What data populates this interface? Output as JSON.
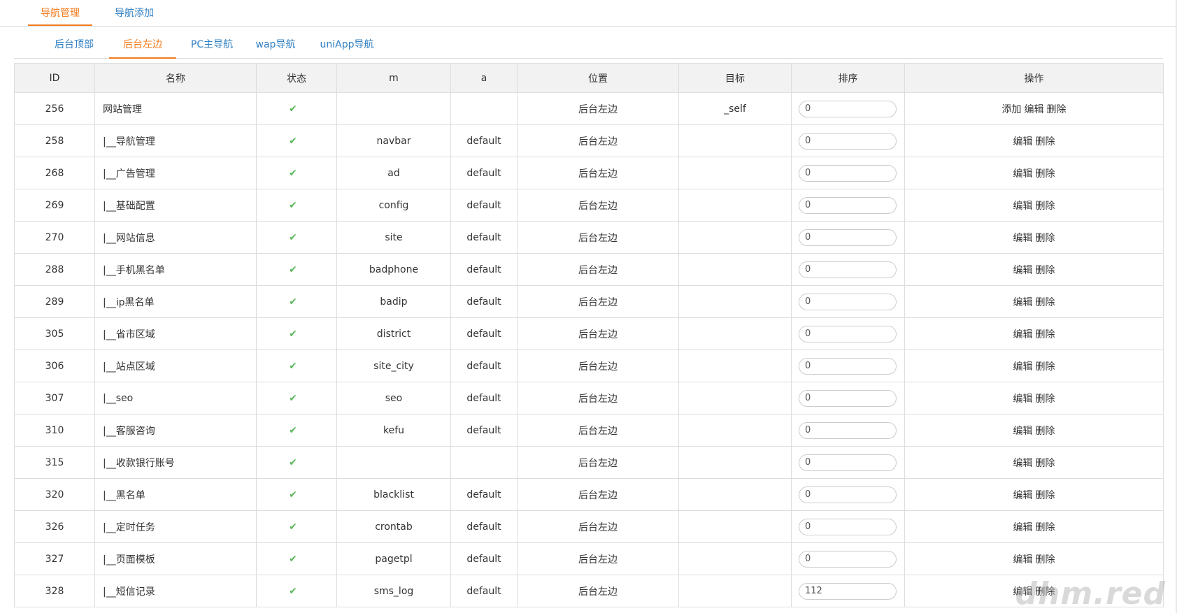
{
  "top_tabs": [
    {
      "label": "导航管理",
      "active": true
    },
    {
      "label": "导航添加",
      "active": false
    }
  ],
  "sub_tabs": [
    {
      "label": "后台顶部",
      "active": false
    },
    {
      "label": "后台左边",
      "active": true
    },
    {
      "label": "PC主导航",
      "active": false
    },
    {
      "label": "wap导航",
      "active": false
    },
    {
      "label": "uniApp导航",
      "active": false
    }
  ],
  "table": {
    "headers": [
      "ID",
      "名称",
      "状态",
      "m",
      "a",
      "位置",
      "目标",
      "排序",
      "操作"
    ],
    "rows": [
      {
        "id": "256",
        "name": "网站管理",
        "m": "",
        "a": "",
        "position": "后台左边",
        "target": "_self",
        "sort": "0",
        "actions": [
          "添加",
          "编辑",
          "删除"
        ]
      },
      {
        "id": "258",
        "name": "|__导航管理",
        "m": "navbar",
        "a": "default",
        "position": "后台左边",
        "target": "",
        "sort": "0",
        "actions": [
          "编辑",
          "删除"
        ]
      },
      {
        "id": "268",
        "name": "|__广告管理",
        "m": "ad",
        "a": "default",
        "position": "后台左边",
        "target": "",
        "sort": "0",
        "actions": [
          "编辑",
          "删除"
        ]
      },
      {
        "id": "269",
        "name": "|__基础配置",
        "m": "config",
        "a": "default",
        "position": "后台左边",
        "target": "",
        "sort": "0",
        "actions": [
          "编辑",
          "删除"
        ]
      },
      {
        "id": "270",
        "name": "|__网站信息",
        "m": "site",
        "a": "default",
        "position": "后台左边",
        "target": "",
        "sort": "0",
        "actions": [
          "编辑",
          "删除"
        ]
      },
      {
        "id": "288",
        "name": "|__手机黑名单",
        "m": "badphone",
        "a": "default",
        "position": "后台左边",
        "target": "",
        "sort": "0",
        "actions": [
          "编辑",
          "删除"
        ]
      },
      {
        "id": "289",
        "name": "|__ip黑名单",
        "m": "badip",
        "a": "default",
        "position": "后台左边",
        "target": "",
        "sort": "0",
        "actions": [
          "编辑",
          "删除"
        ]
      },
      {
        "id": "305",
        "name": "|__省市区域",
        "m": "district",
        "a": "default",
        "position": "后台左边",
        "target": "",
        "sort": "0",
        "actions": [
          "编辑",
          "删除"
        ]
      },
      {
        "id": "306",
        "name": "|__站点区域",
        "m": "site_city",
        "a": "default",
        "position": "后台左边",
        "target": "",
        "sort": "0",
        "actions": [
          "编辑",
          "删除"
        ]
      },
      {
        "id": "307",
        "name": "|__seo",
        "m": "seo",
        "a": "default",
        "position": "后台左边",
        "target": "",
        "sort": "0",
        "actions": [
          "编辑",
          "删除"
        ]
      },
      {
        "id": "310",
        "name": "|__客服咨询",
        "m": "kefu",
        "a": "default",
        "position": "后台左边",
        "target": "",
        "sort": "0",
        "actions": [
          "编辑",
          "删除"
        ]
      },
      {
        "id": "315",
        "name": "|__收款银行账号",
        "m": "",
        "a": "",
        "position": "后台左边",
        "target": "",
        "sort": "0",
        "actions": [
          "编辑",
          "删除"
        ]
      },
      {
        "id": "320",
        "name": "|__黑名单",
        "m": "blacklist",
        "a": "default",
        "position": "后台左边",
        "target": "",
        "sort": "0",
        "actions": [
          "编辑",
          "删除"
        ]
      },
      {
        "id": "326",
        "name": "|__定时任务",
        "m": "crontab",
        "a": "default",
        "position": "后台左边",
        "target": "",
        "sort": "0",
        "actions": [
          "编辑",
          "删除"
        ]
      },
      {
        "id": "327",
        "name": "|__页面模板",
        "m": "pagetpl",
        "a": "default",
        "position": "后台左边",
        "target": "",
        "sort": "0",
        "actions": [
          "编辑",
          "删除"
        ]
      },
      {
        "id": "328",
        "name": "|__短信记录",
        "m": "sms_log",
        "a": "default",
        "position": "后台左边",
        "target": "",
        "sort": "112",
        "actions": [
          "编辑",
          "删除"
        ]
      }
    ]
  },
  "status_icon": "check-icon",
  "watermark": "dhm.red",
  "colors": {
    "accent": "#f37b1d",
    "link": "#2f7fc1",
    "check": "#5cb85c",
    "header_bg": "#f2f2f2",
    "border": "#dddddd"
  }
}
